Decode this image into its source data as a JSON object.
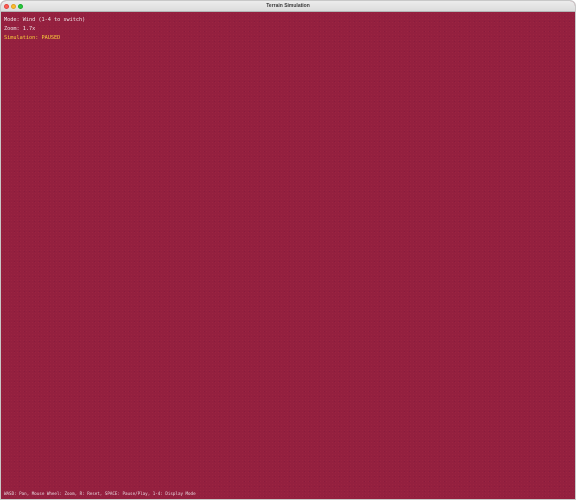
{
  "window": {
    "title": "Terrain Simulation"
  },
  "hud": {
    "mode": "Mode: Wind (1-4 to switch)",
    "zoom": "Zoom: 1.7x",
    "simulation": "Simulation: PAUSED"
  },
  "help": {
    "text": "WASD: Pan, Mouse Wheel: Zoom, R: Reset, SPACE: Pause/Play, 1-4: Display Mode"
  },
  "colors": {
    "terrain_background": "#94203f",
    "status_paused": "#ffd23a",
    "hud_text": "#f2e6ea"
  }
}
